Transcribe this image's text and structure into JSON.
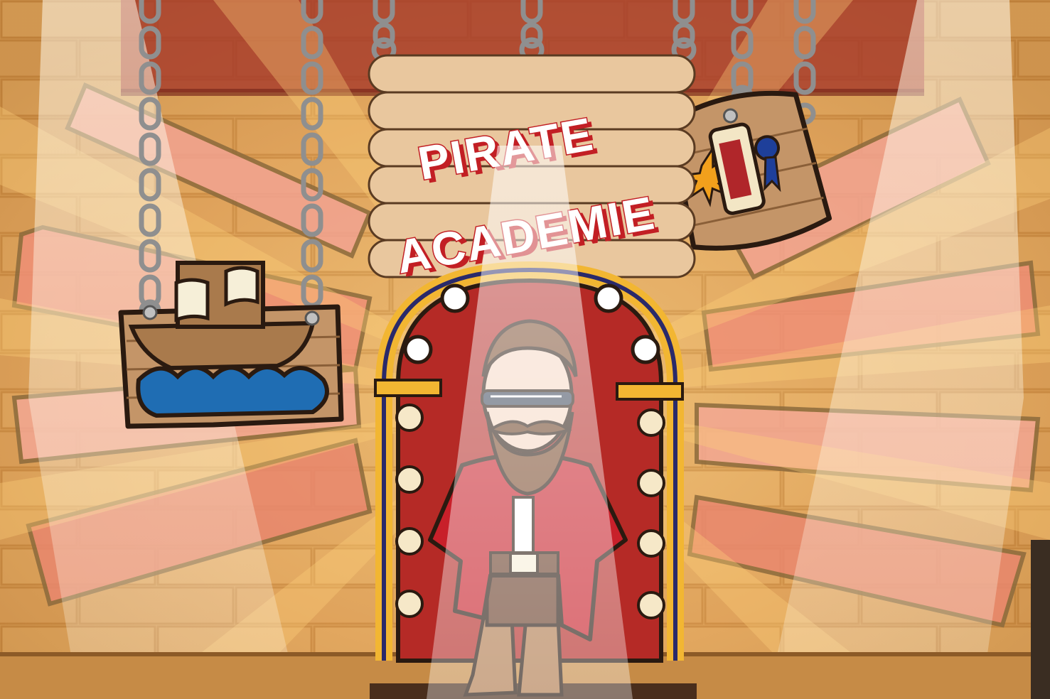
{
  "scene": {
    "sign": {
      "line1": "PIRATE",
      "line2": "ACADEMIE"
    },
    "colors": {
      "wall": "#d9a15a",
      "wall_dark": "#b97a36",
      "board": "#e8c59a",
      "plank": "#c08a50",
      "pink_plank": "#f1a38f",
      "red": "#c21f24",
      "coat_red": "#c8202a",
      "beard": "#7a4a2c",
      "gold": "#f2b632",
      "navy": "#2a2a6a",
      "sea": "#1f6db3",
      "chain": "#9a9a9a",
      "spotlight": "#fff8e6"
    }
  }
}
